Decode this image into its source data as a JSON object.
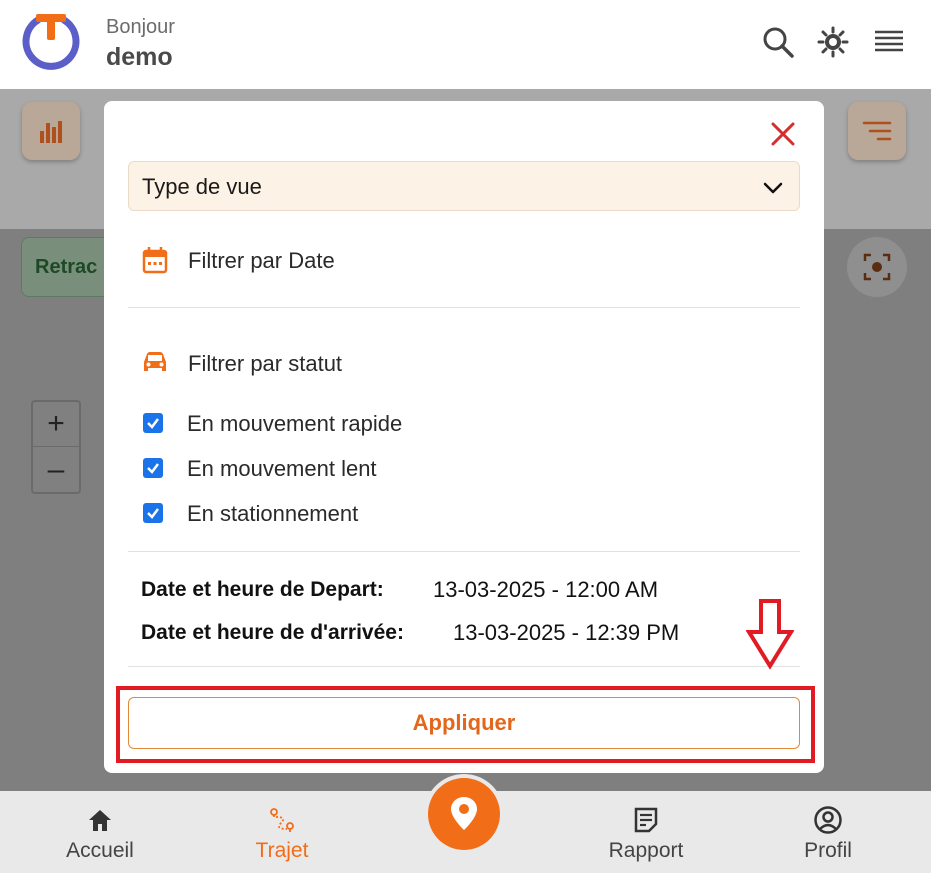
{
  "header": {
    "greeting": "Bonjour",
    "username": "demo",
    "icons": [
      "search-icon",
      "brightness-icon",
      "menu-icon"
    ]
  },
  "background": {
    "pill_label": "Retrac"
  },
  "modal": {
    "select": {
      "label": "Type de vue"
    },
    "date_filter_label": "Filtrer par Date",
    "status_filter_label": "Filtrer par statut",
    "statuses": [
      {
        "label": "En mouvement rapide",
        "checked": true
      },
      {
        "label": "En mouvement lent",
        "checked": true
      },
      {
        "label": "En stationnement",
        "checked": true
      }
    ],
    "departure": {
      "label": "Date et heure de Depart:",
      "value": "13-03-2025 - 12:00 AM"
    },
    "arrival": {
      "label": "Date et heure de d'arrivée:",
      "value": "13-03-2025 - 12:39 PM"
    },
    "apply_label": "Appliquer"
  },
  "nav": {
    "items": [
      {
        "label": "Accueil",
        "icon": "home-icon"
      },
      {
        "label": "Trajet",
        "icon": "route-icon",
        "active": true
      },
      {
        "label": "Rapport",
        "icon": "report-icon"
      },
      {
        "label": "Profil",
        "icon": "profile-icon"
      }
    ]
  },
  "colors": {
    "accent": "#f26d17",
    "checkbox": "#1a73e8",
    "annotation": "#e01b24",
    "logo_blue": "#5b5fc7"
  }
}
